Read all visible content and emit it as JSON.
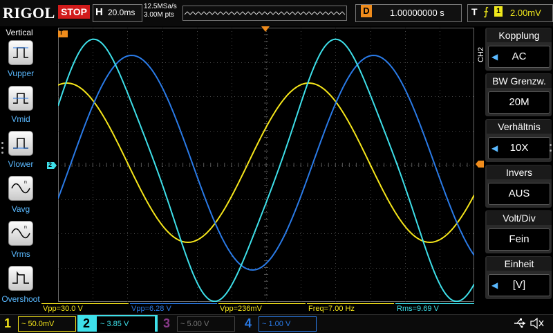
{
  "colors": {
    "ch1": "#f6e61a",
    "ch2": "#3ee0ea",
    "ch3": "#d23ad2",
    "ch4": "#2a7be8",
    "accent": "#5ab9ff",
    "stop": "#d21b1b",
    "trigger": "#f08c1c"
  },
  "header": {
    "brand": "RIGOL",
    "run_state": "STOP",
    "timebase_letter": "H",
    "timebase": "20.0ms",
    "sample_rate": "12.5MSa/s",
    "memory_depth": "3.00M pts",
    "trigger_delay_letter": "D",
    "trigger_delay": "1.00000000 s",
    "trigger_letter": "T",
    "trigger_source": "1",
    "trigger_level": "2.00mV"
  },
  "left_menu": {
    "title": "Vertical",
    "items": [
      "Vupper",
      "Vmid",
      "Vlower",
      "Vavg",
      "Vrms",
      "Overshoot"
    ]
  },
  "right_menu": {
    "channel": "CH2",
    "items": [
      {
        "label": "Kopplung",
        "value": "AC"
      },
      {
        "label": "BW Grenzw.",
        "value": "20M"
      },
      {
        "label": "Verhältnis",
        "value": "10X"
      },
      {
        "label": "Invers",
        "value": "AUS"
      },
      {
        "label": "Volt/Div",
        "value": "Fein"
      },
      {
        "label": "Einheit",
        "value": "[V]"
      }
    ]
  },
  "markers": {
    "ch2_marker": "2",
    "trigger_marker": "T"
  },
  "measurements": [
    {
      "text": "Vpp=30.0 V",
      "channel": "ch1"
    },
    {
      "text": "Vpp=6.28 V",
      "channel": "ch4"
    },
    {
      "text": "Vpp=236mV",
      "channel": "ch1"
    },
    {
      "text": "Freq=7.00 Hz",
      "channel": "ch1"
    },
    {
      "text": "Rms=9.69 V",
      "channel": "ch2"
    }
  ],
  "channels": [
    {
      "num": "1",
      "scale": "~ 50.0mV"
    },
    {
      "num": "2",
      "scale": "~ 3.85 V"
    },
    {
      "num": "3",
      "scale": "~ 5.00 V"
    },
    {
      "num": "4",
      "scale": "~ 1.00 V"
    }
  ]
}
